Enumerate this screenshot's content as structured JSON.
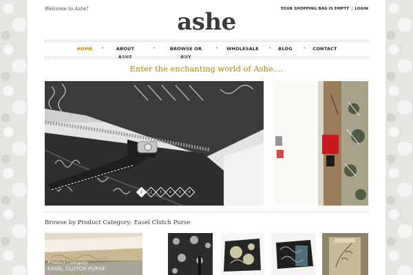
{
  "header": {
    "welcome": "Welcome to Ashe!",
    "shopping_bag": "YOUR SHOPPING BAG IS EMPTY",
    "separator": "|",
    "login": "LOGIN",
    "logo": "ashe"
  },
  "nav": {
    "items": [
      {
        "label_line1": "HOME",
        "label_line2": ""
      },
      {
        "label_line1": "ABOUT",
        "label_line2": "ASHE"
      },
      {
        "label_line1": "BROWSE OR",
        "label_line2": "BUY"
      },
      {
        "label_line1": "WHOLESALE",
        "label_line2": ""
      },
      {
        "label_line1": "BLOG",
        "label_line2": ""
      },
      {
        "label_line1": "CONTACT",
        "label_line2": ""
      }
    ],
    "separator": "•"
  },
  "hero": {
    "tagline": "Enter the enchanting world of Ashe....",
    "slider_dots": [
      "1",
      "2",
      "3",
      "4",
      "5",
      "6"
    ],
    "active_slide": 1
  },
  "browse": {
    "heading": "Browse by Product Category: Easel Clutch Purse",
    "first_thumb_sub": "Product Category",
    "first_thumb_main": "EASEL CLUTCH PURSE"
  },
  "colors": {
    "accent": "#b8860b",
    "text": "#222222",
    "background": "#e9e8e5"
  },
  "icons": {
    "slider_dot": "diamond-outline"
  }
}
